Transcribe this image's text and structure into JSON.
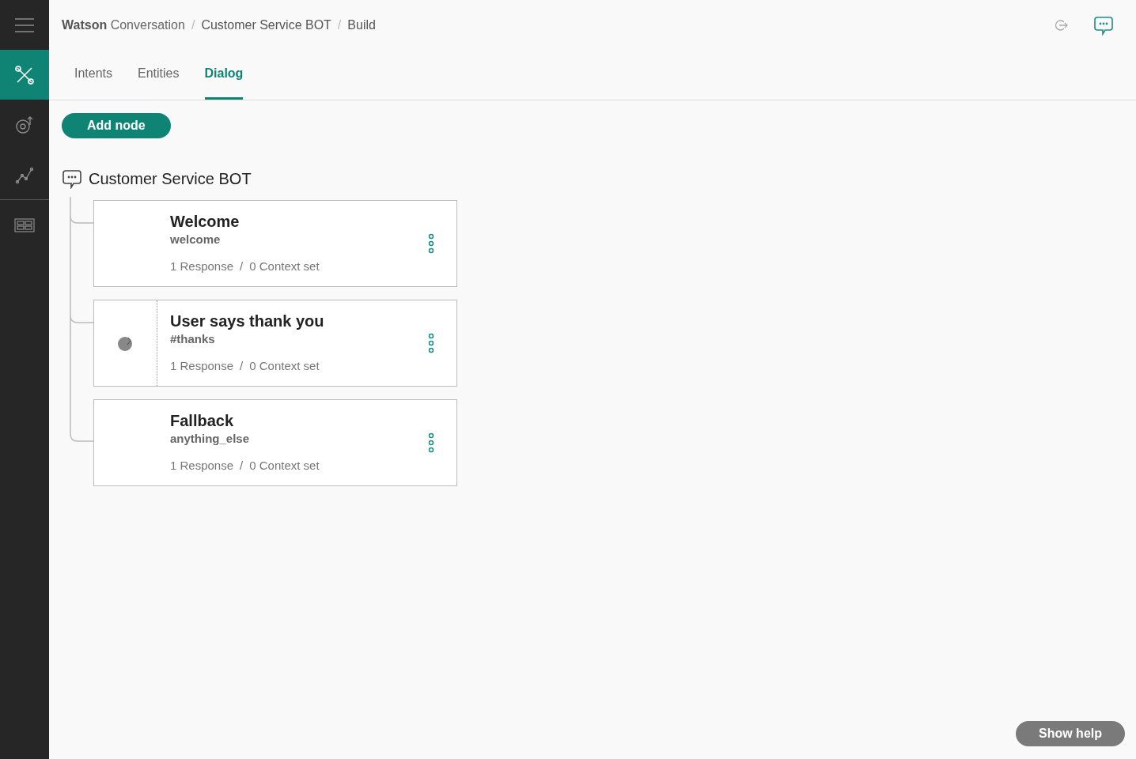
{
  "sidebar": {
    "items": [
      {
        "kind": "tools",
        "selected": true
      },
      {
        "kind": "target",
        "selected": false
      },
      {
        "kind": "chart",
        "selected": false
      },
      {
        "kind": "grid",
        "selected": false
      }
    ]
  },
  "breadcrumb": {
    "product_bold": "Watson",
    "product_rest": "Conversation",
    "items": [
      "Customer Service BOT",
      "Build"
    ],
    "separator": "/"
  },
  "tabs": [
    {
      "label": "Intents",
      "selected": false
    },
    {
      "label": "Entities",
      "selected": false
    },
    {
      "label": "Dialog",
      "selected": true
    }
  ],
  "add_button": "Add node",
  "node_separator": "/",
  "tree": {
    "title": "Customer Service BOT",
    "nodes": [
      {
        "title": "Welcome",
        "condition": "welcome",
        "responses": "1 Response",
        "context": "0 Context set",
        "hovered": false
      },
      {
        "title": "User says thank you",
        "condition": "#thanks",
        "responses": "1 Response",
        "context": "0 Context set",
        "hovered": true
      },
      {
        "title": "Fallback",
        "condition": "anything_else",
        "responses": "1 Response",
        "context": "0 Context set",
        "hovered": false
      }
    ]
  },
  "help_button": "Show help"
}
